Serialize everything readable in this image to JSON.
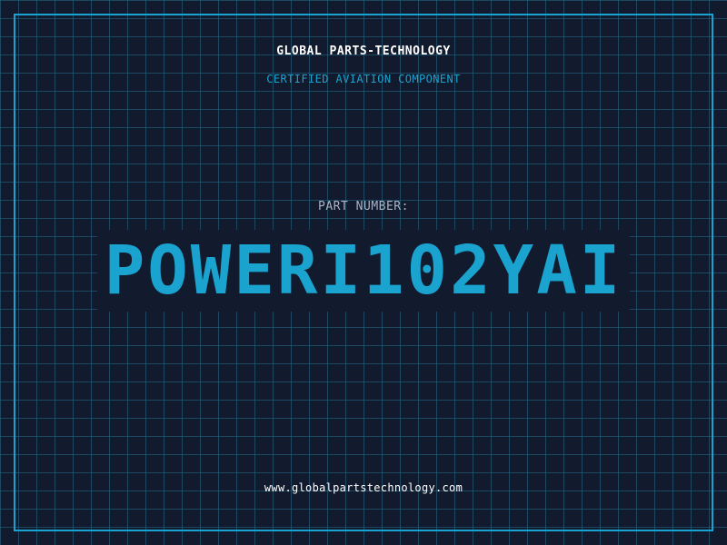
{
  "header": {
    "brand": "GLOBAL PARTS-TECHNOLOGY",
    "subtitle": "CERTIFIED AVIATION COMPONENT"
  },
  "main": {
    "part_number_label": "PART NUMBER:",
    "part_number": "POWERI102YAI"
  },
  "footer": {
    "website": "www.globalpartstechnology.com"
  },
  "colors": {
    "background": "#121a2e",
    "accent": "#1ba3cf",
    "grid": "#286e8c",
    "text_primary": "#ffffff",
    "text_muted": "#a9b4c4"
  }
}
